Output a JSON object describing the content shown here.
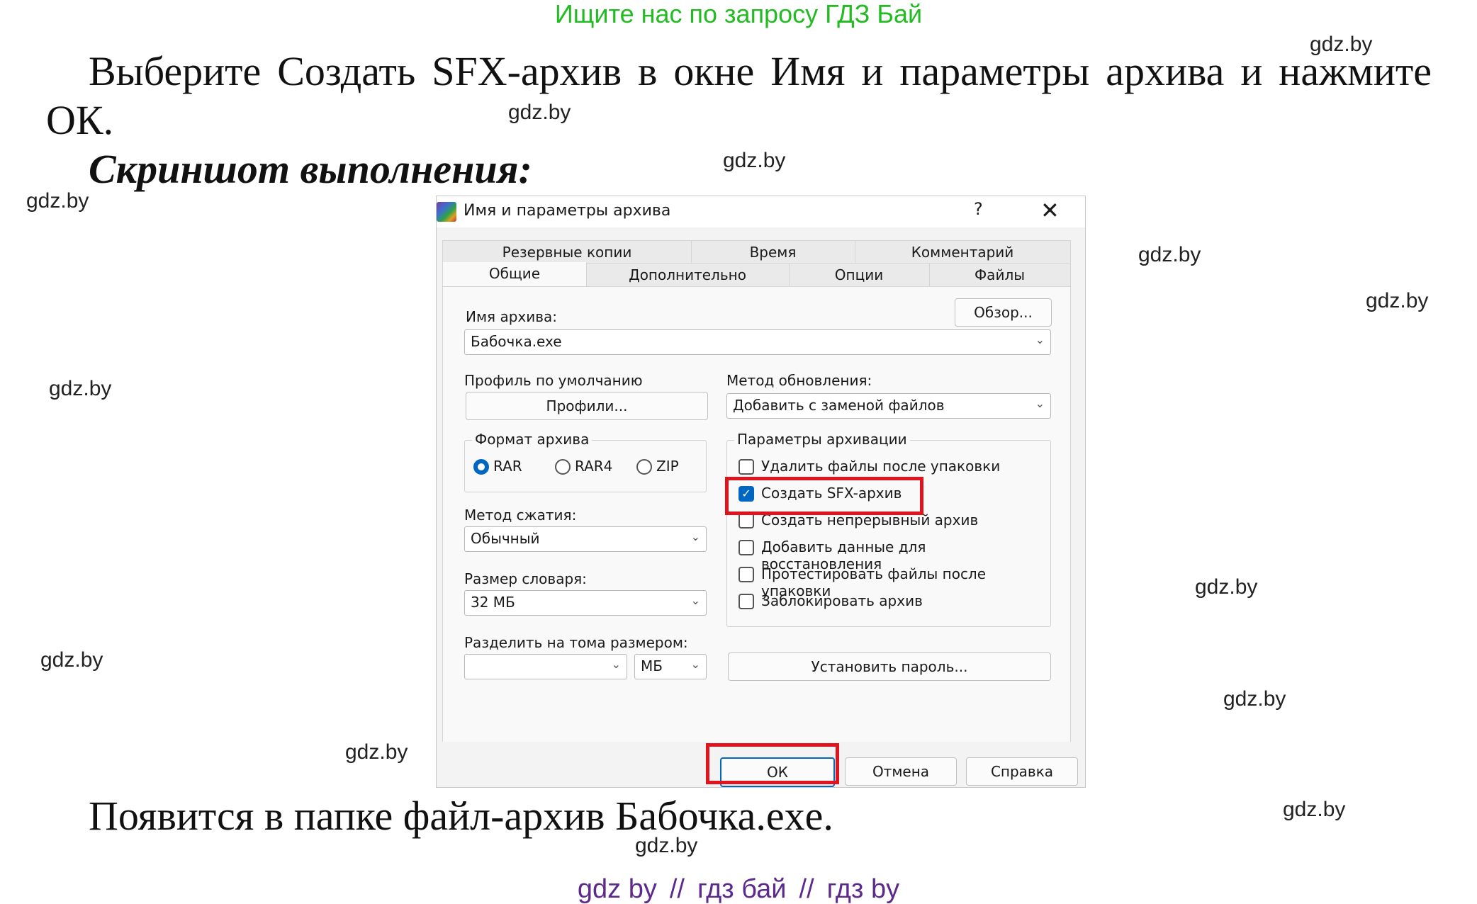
{
  "top_banner": "Ищите нас по запросу ГДЗ Бай",
  "paragraph1_line1": "Выберите Создать SFX-архив в окне Имя и параметры архива и нажмите",
  "paragraph1_line2": "ОК.",
  "heading": "Скриншот выполнения:",
  "paragraph2": "Появится в папке файл-архив Бабочка.exe.",
  "watermark": "gdz.by",
  "bottom_links": [
    "gdz by",
    "гдз бай",
    "гдз by"
  ],
  "bottom_sep": "//",
  "dialog": {
    "title": "Имя и параметры архива",
    "help": "?",
    "close": "✕",
    "tabs_row1": [
      "Резервные копии",
      "Время",
      "Комментарий"
    ],
    "tabs_row2": [
      "Общие",
      "Дополнительно",
      "Опции",
      "Файлы"
    ],
    "archive_name_label": "Имя архива:",
    "browse": "Обзор...",
    "archive_name": "Бабочка.exe",
    "profile_label": "Профиль по умолчанию",
    "profiles_button": "Профили...",
    "update_method_label": "Метод обновления:",
    "update_method": "Добавить с заменой файлов",
    "format_group": "Формат архива",
    "formats": [
      {
        "label": "RAR",
        "selected": true
      },
      {
        "label": "RAR4",
        "selected": false
      },
      {
        "label": "ZIP",
        "selected": false
      }
    ],
    "compression_label": "Метод сжатия:",
    "compression": "Обычный",
    "dict_label": "Размер словаря:",
    "dict": "32 МБ",
    "split_label": "Разделить на тома размером:",
    "split_value": "",
    "split_unit": "МБ",
    "options_group": "Параметры архивации",
    "options": [
      {
        "label": "Удалить файлы после упаковки",
        "checked": false
      },
      {
        "label": "Создать SFX-архив",
        "checked": true
      },
      {
        "label": "Создать непрерывный архив",
        "checked": false
      },
      {
        "label": "Добавить данные для восстановления",
        "checked": false
      },
      {
        "label": "Протестировать файлы после упаковки",
        "checked": false
      },
      {
        "label": "Заблокировать архив",
        "checked": false
      }
    ],
    "set_password": "Установить пароль...",
    "ok": "ОК",
    "cancel": "Отмена",
    "help_button": "Справка"
  },
  "colors": {
    "banner": "#22bb22",
    "highlight": "#e0141e",
    "accent": "#0067c0",
    "links": "#5b2a8c"
  }
}
